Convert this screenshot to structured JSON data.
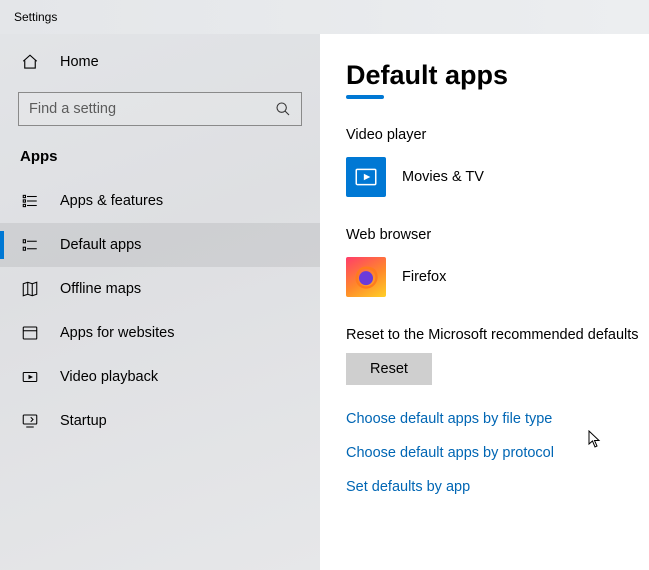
{
  "window": {
    "title": "Settings"
  },
  "sidebar": {
    "home_label": "Home",
    "search_placeholder": "Find a setting",
    "section_title": "Apps",
    "items": [
      {
        "label": "Apps & features"
      },
      {
        "label": "Default apps"
      },
      {
        "label": "Offline maps"
      },
      {
        "label": "Apps for websites"
      },
      {
        "label": "Video playback"
      },
      {
        "label": "Startup"
      }
    ],
    "active_index": 1
  },
  "content": {
    "heading": "Default apps",
    "video_player_label": "Video player",
    "video_player_app": "Movies & TV",
    "web_browser_label": "Web browser",
    "web_browser_app": "Firefox",
    "reset_label": "Reset to the Microsoft recommended defaults",
    "reset_button": "Reset",
    "links": {
      "by_file_type": "Choose default apps by file type",
      "by_protocol": "Choose default apps by protocol",
      "by_app": "Set defaults by app"
    }
  }
}
